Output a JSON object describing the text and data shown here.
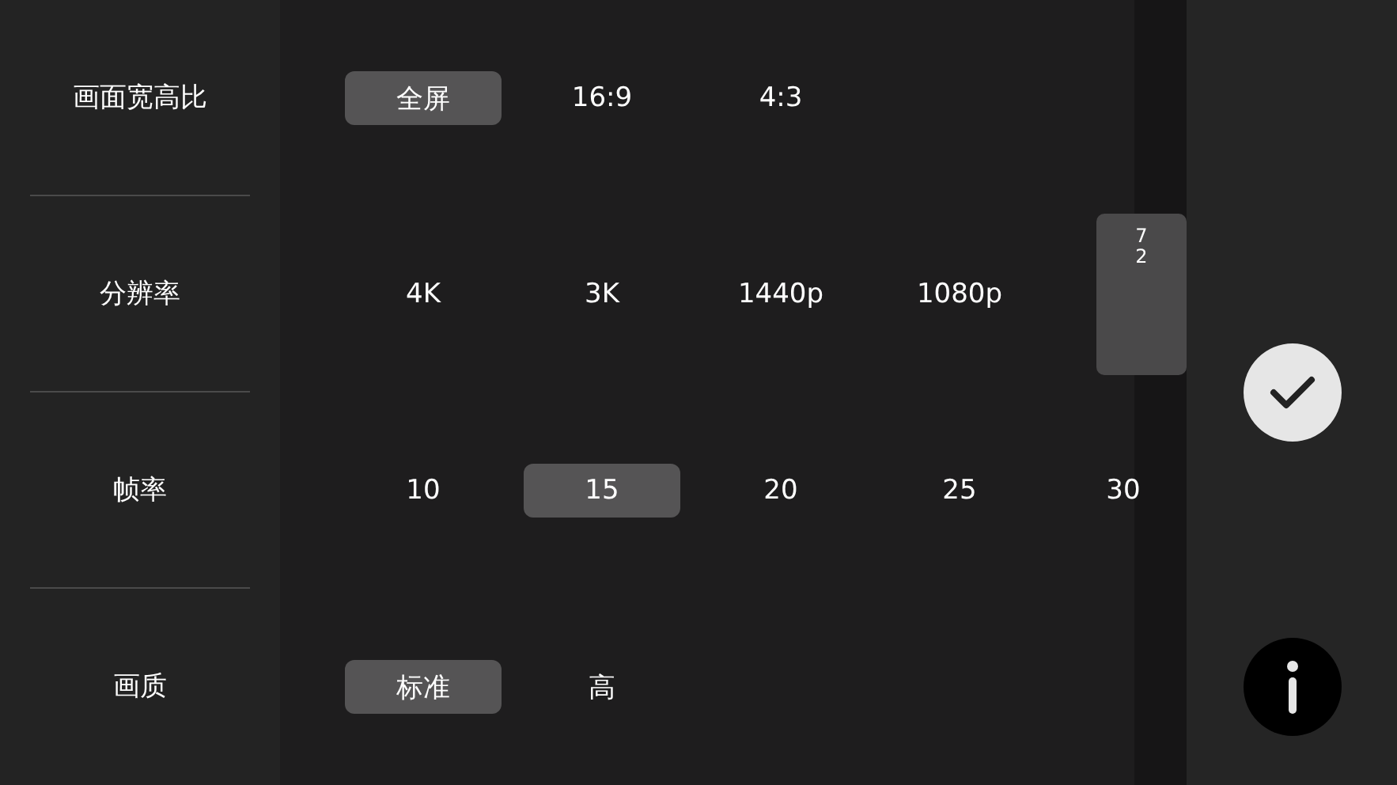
{
  "settings": [
    {
      "label": "画面宽高比",
      "options": [
        {
          "label": "全屏",
          "selected": true
        },
        {
          "label": "16:9",
          "selected": false
        },
        {
          "label": "4:3",
          "selected": false
        }
      ]
    },
    {
      "label": "分辨率",
      "options": [
        {
          "label": "4K",
          "selected": false
        },
        {
          "label": "3K",
          "selected": false
        },
        {
          "label": "1440p",
          "selected": false
        },
        {
          "label": "1080p",
          "selected": false
        },
        {
          "label": "72",
          "selected": true,
          "kind": "cut"
        }
      ]
    },
    {
      "label": "帧率",
      "options": [
        {
          "label": "10",
          "selected": false
        },
        {
          "label": "15",
          "selected": true
        },
        {
          "label": "20",
          "selected": false
        },
        {
          "label": "25",
          "selected": false
        },
        {
          "label": "30",
          "selected": false
        }
      ]
    },
    {
      "label": "画质",
      "options": [
        {
          "label": "标准",
          "selected": true
        },
        {
          "label": "高",
          "selected": false
        }
      ]
    }
  ]
}
